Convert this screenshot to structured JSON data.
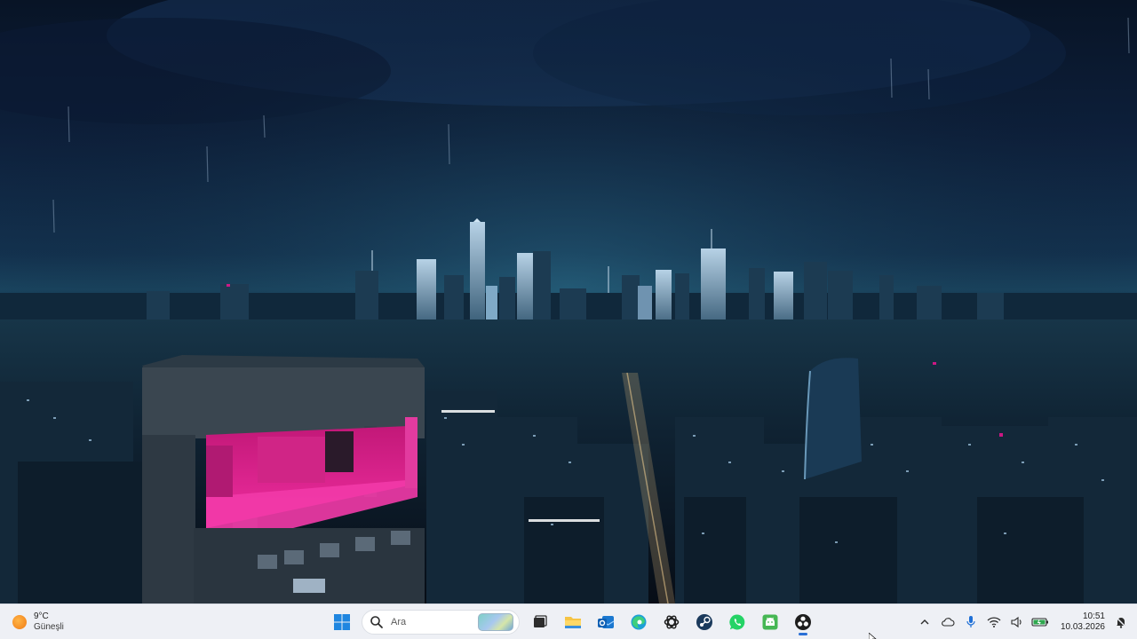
{
  "weather": {
    "temperature": "9°C",
    "condition": "Güneşli"
  },
  "search": {
    "label": "Ara"
  },
  "taskbar_apps": [
    {
      "name": "start",
      "icon": "windows-logo-icon"
    },
    {
      "name": "widgets",
      "icon": "widgets-icon"
    },
    {
      "name": "task-view",
      "icon": "task-view-icon"
    },
    {
      "name": "file-explorer",
      "icon": "folder-icon"
    },
    {
      "name": "outlook",
      "icon": "outlook-icon"
    },
    {
      "name": "edge",
      "icon": "edge-icon"
    },
    {
      "name": "chatgpt",
      "icon": "chatgpt-icon"
    },
    {
      "name": "steam",
      "icon": "steam-icon"
    },
    {
      "name": "whatsapp",
      "icon": "whatsapp-icon"
    },
    {
      "name": "android-studio",
      "icon": "android-icon"
    },
    {
      "name": "obs",
      "icon": "obs-icon"
    }
  ],
  "tray": {
    "icons": [
      "chevron-up-icon",
      "cloud-icon",
      "microphone-icon",
      "wifi-icon",
      "speaker-icon",
      "battery-icon"
    ],
    "time": "10:51",
    "date": "10.03.2026"
  },
  "colors": {
    "taskbar_bg": "#eef0f5",
    "active_indicator": "#2a6fd6",
    "accent_pink": "#e0168c"
  }
}
